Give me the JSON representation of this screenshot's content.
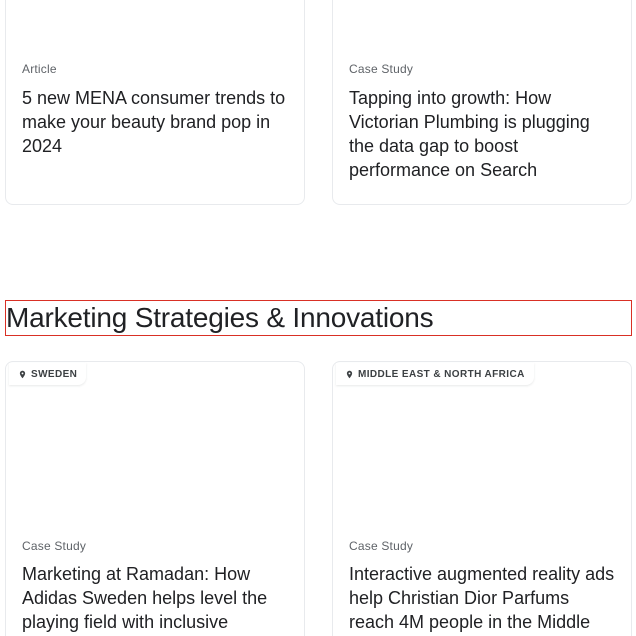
{
  "top_cards": [
    {
      "type": "Article",
      "title": "5 new MENA consumer trends to make your beauty brand pop in 2024"
    },
    {
      "type": "Case Study",
      "title": "Tapping into growth: How Victorian Plumbing is plugging the data gap to boost performance on Search"
    }
  ],
  "section": {
    "heading": "Marketing Strategies & Innovations",
    "highlight_color": "#d93025"
  },
  "bottom_cards": [
    {
      "location": "SWEDEN",
      "location_icon": "location-pin-icon",
      "type": "Case Study",
      "title": "Marketing at Ramadan: How Adidas Sweden helps level the playing field with inclusive"
    },
    {
      "location": "MIDDLE EAST & NORTH AFRICA",
      "location_icon": "location-pin-icon",
      "type": "Case Study",
      "title": "Interactive augmented reality ads help Christian Dior Parfums reach 4M people in the Middle"
    }
  ]
}
